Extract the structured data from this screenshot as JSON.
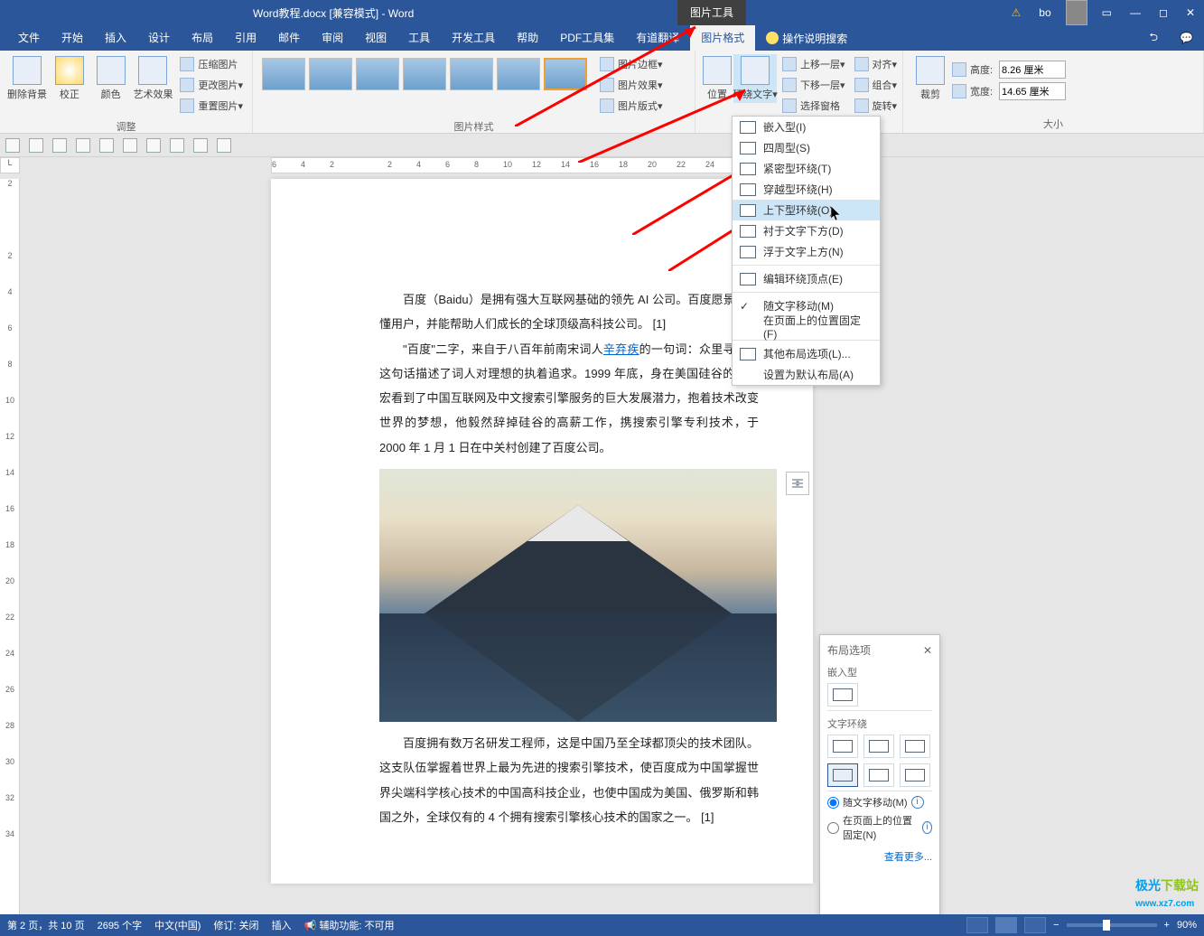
{
  "title": "Word教程.docx [兼容模式] - Word",
  "user": "bo",
  "contextTab": "图片工具",
  "tabs": [
    "文件",
    "开始",
    "插入",
    "设计",
    "布局",
    "引用",
    "邮件",
    "审阅",
    "视图",
    "工具",
    "开发工具",
    "帮助",
    "PDF工具集",
    "有道翻译",
    "图片格式"
  ],
  "activeTab": "图片格式",
  "tellMe": "操作说明搜索",
  "ribbon": {
    "adjust": {
      "label": "调整",
      "removeBg": "删除背景",
      "corrections": "校正",
      "color": "颜色",
      "artistic": "艺术效果",
      "compress": "压缩图片",
      "change": "更改图片",
      "reset": "重置图片"
    },
    "styleLabel": "图片样式",
    "styleSide": {
      "border": "图片边框",
      "effects": "图片效果",
      "layout": "图片版式"
    },
    "arrange": {
      "position": "位置",
      "wrap": "环绕文字",
      "forward": "上移一层",
      "backward": "下移一层",
      "selection": "选择窗格",
      "align": "对齐",
      "group": "组合",
      "rotate": "旋转"
    },
    "size": {
      "label": "大小",
      "crop": "裁剪",
      "h": "高度:",
      "w": "宽度:",
      "hval": "8.26 厘米",
      "wval": "14.65 厘米"
    }
  },
  "wrapMenu": {
    "items": [
      {
        "t": "嵌入型(I)"
      },
      {
        "t": "四周型(S)"
      },
      {
        "t": "紧密型环绕(T)"
      },
      {
        "t": "穿越型环绕(H)"
      },
      {
        "t": "上下型环绕(O)",
        "hov": true
      },
      {
        "t": "衬于文字下方(D)"
      },
      {
        "t": "浮于文字上方(N)"
      }
    ],
    "edit": "编辑环绕顶点(E)",
    "move": "随文字移动(M)",
    "fix": "在页面上的位置固定(F)",
    "more": "其他布局选项(L)...",
    "default": "设置为默认布局(A)"
  },
  "doc": {
    "p1": "百度（Baidu）是拥有强大互联网基础的领先 AI 公司。百度愿景为最懂用户，并能帮助人们成长的全球顶级高科技公司。 [1]",
    "p2a": "\"百度\"二字，来自于八百年前南宋词人",
    "p2link": "辛弃疾",
    "p2b": "的一句词：众里寻度。这句话描述了词人对理想的执着追求。1999 年底，身在美国硅谷的李彦宏看到了中国互联网及中文搜索引擎服务的巨大发展潜力，抱着技术改变世界的梦想，他毅然辞掉硅谷的高薪工作，携搜索引擎专利技术，于 2000 年 1 月 1 日在中关村创建了百度公司。",
    "p3": "百度拥有数万名研发工程师，这是中国乃至全球都顶尖的技术团队。这支队伍掌握着世界上最为先进的搜索引擎技术，使百度成为中国掌握世界尖端科学核心技术的中国高科技企业，也使中国成为美国、俄罗斯和韩国之外，全球仅有的 4 个拥有搜索引擎核心技术的国家之一。 [1]"
  },
  "layoutPane": {
    "title": "布局选项",
    "inline": "嵌入型",
    "wrap": "文字环绕",
    "move": "随文字移动(M)",
    "fix": "在页面上的位置固定(N)",
    "more": "查看更多..."
  },
  "status": {
    "page": "第 2 页，共 10 页",
    "words": "2695 个字",
    "lang": "中文(中国)",
    "track": "修订: 关闭",
    "insert": "插入",
    "a11y": "辅助功能: 不可用",
    "zoom": "90%"
  },
  "hruler": [
    6,
    4,
    2,
    "",
    2,
    4,
    6,
    8,
    10,
    12,
    14,
    16,
    18,
    20,
    22,
    24,
    26,
    28,
    30
  ],
  "vruler": [
    "2",
    "",
    "2",
    "4",
    "6",
    "8",
    "10",
    "12",
    "14",
    "16",
    "18",
    "20",
    "22",
    "24",
    "26",
    "28",
    "30",
    "32",
    "34"
  ]
}
